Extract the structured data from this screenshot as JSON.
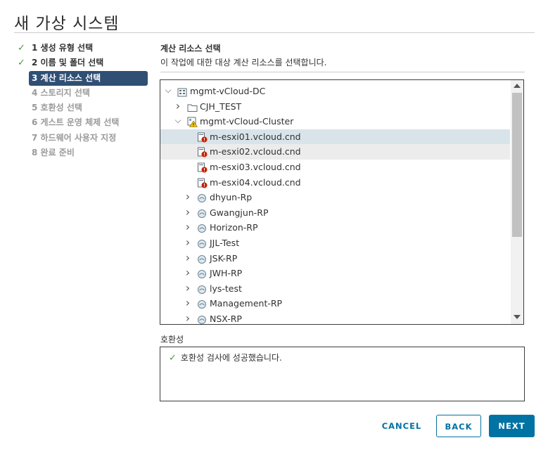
{
  "window": {
    "title": "새 가상 시스템"
  },
  "steps": [
    {
      "label": "1 생성 유형 선택",
      "state": "done"
    },
    {
      "label": "2 이름 및 폴더 선택",
      "state": "done"
    },
    {
      "label": "3 계산 리소스 선택",
      "state": "active"
    },
    {
      "label": "4 스토리지 선택",
      "state": "pending"
    },
    {
      "label": "5 호환성 선택",
      "state": "pending"
    },
    {
      "label": "6 게스트 운영 체제 선택",
      "state": "pending"
    },
    {
      "label": "7 하드웨어 사용자 지정",
      "state": "pending"
    },
    {
      "label": "8 완료 준비",
      "state": "pending"
    }
  ],
  "main": {
    "title": "계산 리소스 선택",
    "subtitle": "이 작업에 대한 대상 계산 리소스를 선택합니다."
  },
  "tree": {
    "items": [
      {
        "label": "mgmt-vCloud-DC",
        "icon": "datacenter-icon",
        "indent": 0,
        "expanded": true,
        "state": ""
      },
      {
        "label": "CJH_TEST",
        "icon": "folder-icon",
        "indent": 1,
        "expanded": false,
        "state": ""
      },
      {
        "label": "mgmt-vCloud-Cluster",
        "icon": "cluster-warning-icon",
        "indent": 1,
        "expanded": true,
        "state": ""
      },
      {
        "label": "m-esxi01.vcloud.cnd",
        "icon": "host-error-icon",
        "indent": 2,
        "expanded": null,
        "state": "selected"
      },
      {
        "label": "m-esxi02.vcloud.cnd",
        "icon": "host-error-icon",
        "indent": 2,
        "expanded": null,
        "state": "hover"
      },
      {
        "label": "m-esxi03.vcloud.cnd",
        "icon": "host-error-icon",
        "indent": 2,
        "expanded": null,
        "state": ""
      },
      {
        "label": "m-esxi04.vcloud.cnd",
        "icon": "host-error-icon",
        "indent": 2,
        "expanded": null,
        "state": ""
      },
      {
        "label": "dhyun-Rp",
        "icon": "resource-pool-icon",
        "indent": 2,
        "expanded": false,
        "state": ""
      },
      {
        "label": "Gwangjun-RP",
        "icon": "resource-pool-icon",
        "indent": 2,
        "expanded": false,
        "state": ""
      },
      {
        "label": "Horizon-RP",
        "icon": "resource-pool-icon",
        "indent": 2,
        "expanded": false,
        "state": ""
      },
      {
        "label": "JJL-Test",
        "icon": "resource-pool-icon",
        "indent": 2,
        "expanded": false,
        "state": ""
      },
      {
        "label": "JSK-RP",
        "icon": "resource-pool-icon",
        "indent": 2,
        "expanded": false,
        "state": ""
      },
      {
        "label": "JWH-RP",
        "icon": "resource-pool-icon",
        "indent": 2,
        "expanded": false,
        "state": ""
      },
      {
        "label": "lys-test",
        "icon": "resource-pool-icon",
        "indent": 2,
        "expanded": false,
        "state": ""
      },
      {
        "label": "Management-RP",
        "icon": "resource-pool-icon",
        "indent": 2,
        "expanded": false,
        "state": ""
      },
      {
        "label": "NSX-RP",
        "icon": "resource-pool-icon",
        "indent": 2,
        "expanded": false,
        "state": ""
      }
    ]
  },
  "compat": {
    "label": "호환성",
    "message": "호환성 검사에 성공했습니다."
  },
  "buttons": {
    "cancel": "CANCEL",
    "back": "BACK",
    "next": "NEXT"
  },
  "colors": {
    "accent": "#0072a3",
    "active_step": "#304f74",
    "success": "#4a9a3c",
    "error": "#c92100",
    "warning": "#f5c300"
  }
}
